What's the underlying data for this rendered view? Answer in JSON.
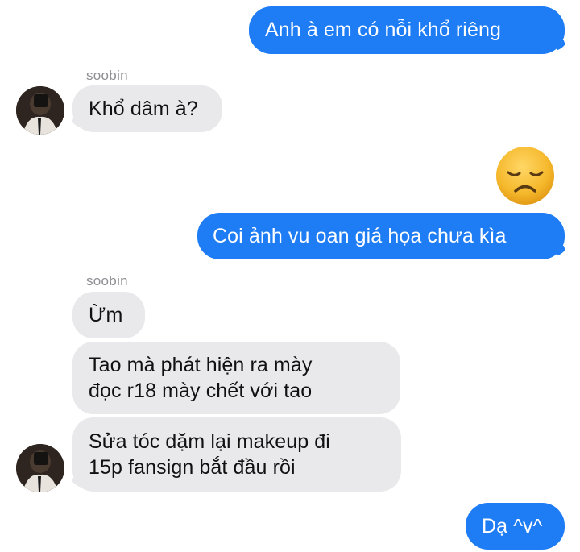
{
  "thread": {
    "messages": [
      {
        "side": "sent",
        "text": "Anh à em có nỗi khổ riêng"
      },
      {
        "side": "received",
        "sender": "soobin",
        "text": "Khổ dâm à?"
      },
      {
        "side": "sent",
        "emoji": "disappointed-face"
      },
      {
        "side": "sent",
        "text": "Coi ảnh vu oan giá họa chưa kìa"
      },
      {
        "side": "received",
        "sender": "soobin",
        "text": "Ừm"
      },
      {
        "side": "received",
        "lines": [
          "Tao mà phát hiện ra mày",
          "đọc r18 mày chết với tao"
        ]
      },
      {
        "side": "received",
        "lines": [
          "Sửa tóc dặm lại makeup đi",
          "15p fansign bắt đầu rồi"
        ]
      },
      {
        "side": "sent",
        "text": "Dạ ^v^"
      }
    ]
  },
  "colors": {
    "sent_bubble": "#1e7cf5",
    "received_bubble": "#e9e9ec",
    "sender_name": "#8e8e93",
    "background": "#ffffff"
  }
}
